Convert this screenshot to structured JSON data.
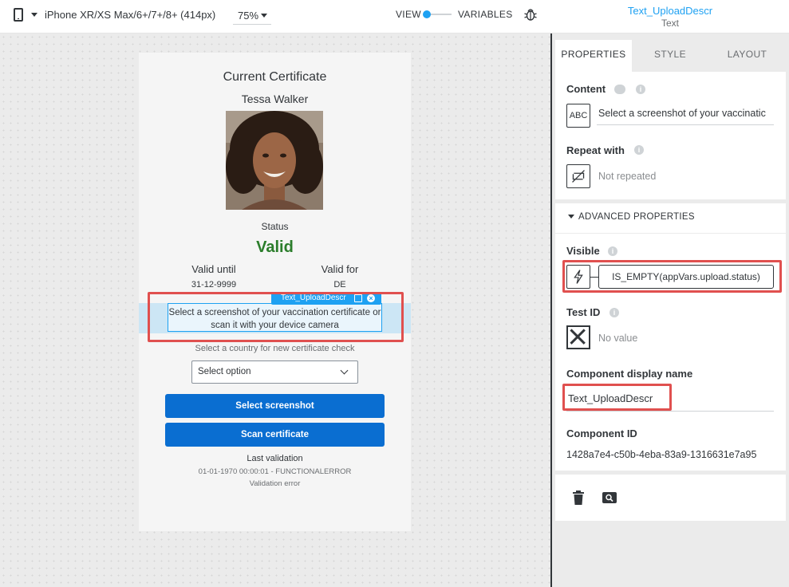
{
  "topbar": {
    "device_label": "iPhone XR/XS Max/6+/7+/8+ (414px)",
    "zoom_label": "75%",
    "view_label": "VIEW",
    "variables_label": "VARIABLES",
    "selected_component_name": "Text_UploadDescr",
    "selected_component_type": "Text"
  },
  "phone": {
    "title": "Current Certificate",
    "name": "Tessa Walker",
    "status_label": "Status",
    "status_value": "Valid",
    "status_color": "#2b7d2b",
    "valid_until_label": "Valid until",
    "valid_until_value": "31-12-9999",
    "valid_for_label": "Valid for",
    "valid_for_value": "DE",
    "selected_tag": "Text_UploadDescr",
    "upload_description": "Select a screenshot of your vaccination certificate or scan it with your device camera",
    "country_label": "Select a country for new certificate check",
    "select_placeholder": "Select option",
    "select_screenshot_button": "Select screenshot",
    "scan_certificate_button": "Scan certificate",
    "last_validation_label": "Last validation",
    "last_validation_value": "01-01-1970 00:00:01 - FUNCTIONALERROR",
    "validation_error": "Validation error"
  },
  "panel": {
    "tabs": [
      {
        "label": "PROPERTIES",
        "active": true
      },
      {
        "label": "STYLE",
        "active": false
      },
      {
        "label": "LAYOUT",
        "active": false
      }
    ],
    "content_label": "Content",
    "content_value": "Select a screenshot of your vaccinatic",
    "abc_icon_text": "ABC",
    "repeat_label": "Repeat with",
    "repeat_value": "Not repeated",
    "advanced_label": "ADVANCED PROPERTIES",
    "visible_label": "Visible",
    "visible_formula": "IS_EMPTY(appVars.upload.status)",
    "test_id_label": "Test ID",
    "test_id_value": "No value",
    "display_name_label": "Component display name",
    "display_name_value": "Text_UploadDescr",
    "component_id_label": "Component ID",
    "component_id_value": "1428a7e4-c50b-4eba-83a9-1316631e7a95"
  },
  "colors": {
    "accent": "#1ea1f2",
    "button": "#0a6ed1",
    "highlight": "#e0504f"
  },
  "icons": [
    "phone-icon",
    "bug-icon",
    "link-icon",
    "info-icon",
    "abc-text-icon",
    "no-repeat-icon",
    "bolt-icon",
    "x-icon",
    "trash-icon",
    "search-icon",
    "copy-icon",
    "close-icon"
  ]
}
